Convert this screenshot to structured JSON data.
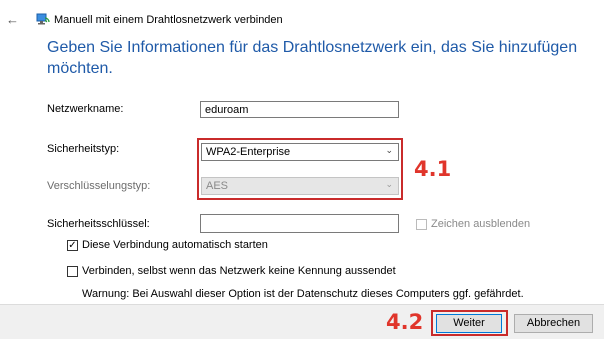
{
  "window": {
    "title": "Manuell mit einem Drahtlosnetzwerk verbinden",
    "back_icon": "back-arrow-icon",
    "network_icon": "network-icon"
  },
  "heading": "Geben Sie Informationen für das Drahtlosnetzwerk ein, das Sie hinzufügen möchten.",
  "form": {
    "network_name": {
      "label": "Netzwerkname:",
      "value": "eduroam"
    },
    "security_type": {
      "label": "Sicherheitstyp:",
      "value": "WPA2-Enterprise"
    },
    "encryption_type": {
      "label": "Verschlüsselungstyp:",
      "value": "AES"
    },
    "security_key": {
      "label": "Sicherheitsschlüssel:",
      "value": ""
    },
    "hide_chars": {
      "label": "Zeichen ausblenden",
      "checked": false
    },
    "auto_start": {
      "label": "Diese Verbindung automatisch starten",
      "checked": true
    },
    "connect_hidden": {
      "label": "Verbinden, selbst wenn das Netzwerk keine Kennung aussendet",
      "checked": false
    },
    "warning": "Warnung: Bei Auswahl dieser Option ist der Datenschutz dieses Computers ggf. gefährdet."
  },
  "annotations": {
    "step1": "4.1",
    "step2": "4.2"
  },
  "buttons": {
    "next": "Weiter",
    "cancel": "Abbrechen"
  },
  "colors": {
    "heading": "#1f5aa8",
    "annotation": "#e0352b",
    "primary_border": "#0078d7"
  }
}
